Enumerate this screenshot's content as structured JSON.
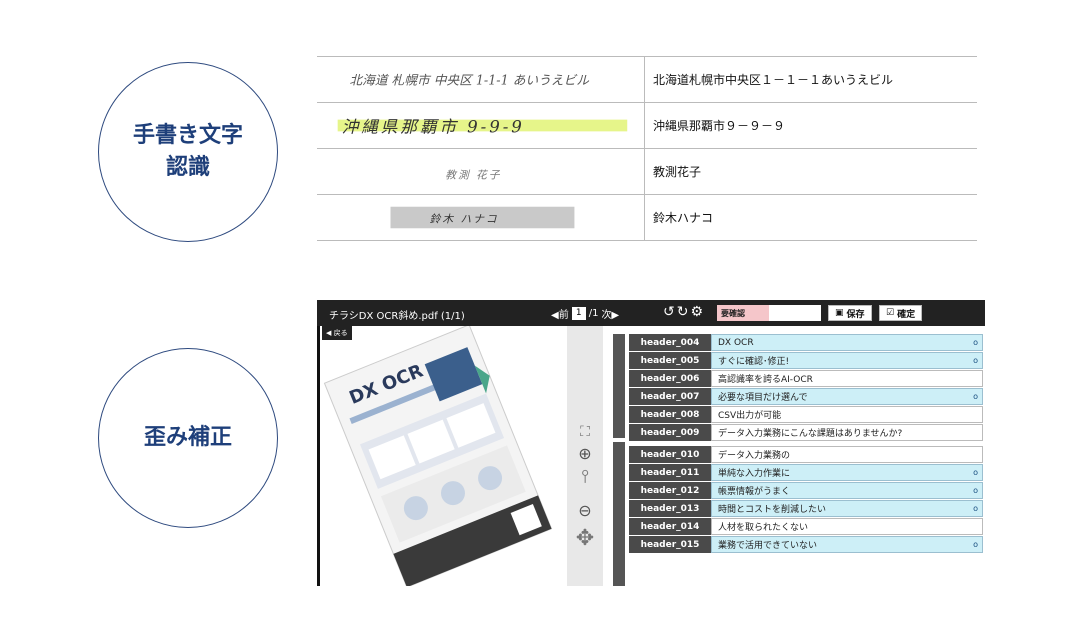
{
  "features": [
    {
      "lines": [
        "手書き文字",
        "認識"
      ]
    },
    {
      "lines": [
        "歪み補正"
      ]
    }
  ],
  "handwriting_table": [
    {
      "handwriting": "北海道 札幌市 中央区 1-1-1 あいうえビル",
      "recognized": "北海道札幌市中央区１－１－１あいうえビル"
    },
    {
      "handwriting": "沖縄県那覇市 9-9-9",
      "recognized": "沖縄県那覇市９－９－９"
    },
    {
      "handwriting": "教測 花子",
      "recognized": "教測花子"
    },
    {
      "handwriting": "鈴木 ハナコ",
      "recognized": "鈴木ハナコ"
    }
  ],
  "viewer": {
    "filename": "チラシDX OCR斜め.pdf (1/1)",
    "prev_label": "◀前",
    "page_current": "1",
    "page_total": "/1",
    "next_label": "次▶",
    "confirm_status": "要確認",
    "save_label": "保存",
    "confirm_label": "確定",
    "back_label": "◀ 戻る"
  },
  "fields": [
    {
      "key": "header_004",
      "value": "DX OCR",
      "highlight": true,
      "dot": true
    },
    {
      "key": "header_005",
      "value": "すぐに確認･修正!",
      "highlight": true,
      "dot": true
    },
    {
      "key": "header_006",
      "value": "高認識率を誇るAI-OCR",
      "highlight": false,
      "dot": false
    },
    {
      "key": "header_007",
      "value": "必要な項目だけ選んで",
      "highlight": true,
      "dot": true
    },
    {
      "key": "header_008",
      "value": "CSV出力が可能",
      "highlight": false,
      "dot": false
    },
    {
      "key": "header_009",
      "value": "データ入力業務にこんな課題はありませんか?",
      "highlight": false,
      "dot": false
    },
    {
      "key": "header_010",
      "value": "データ入力業務の",
      "highlight": false,
      "dot": false
    },
    {
      "key": "header_011",
      "value": "単純な入力作業に",
      "highlight": true,
      "dot": true
    },
    {
      "key": "header_012",
      "value": "帳票情報がうまく",
      "highlight": true,
      "dot": true
    },
    {
      "key": "header_013",
      "value": "時間とコストを削減したい",
      "highlight": true,
      "dot": true
    },
    {
      "key": "header_014",
      "value": "人材を取られたくない",
      "highlight": false,
      "dot": false
    },
    {
      "key": "header_015",
      "value": "業務で活用できていない",
      "highlight": true,
      "dot": true
    }
  ],
  "dot_glyph": "o",
  "flyer": {
    "brand": "DX OCR"
  }
}
